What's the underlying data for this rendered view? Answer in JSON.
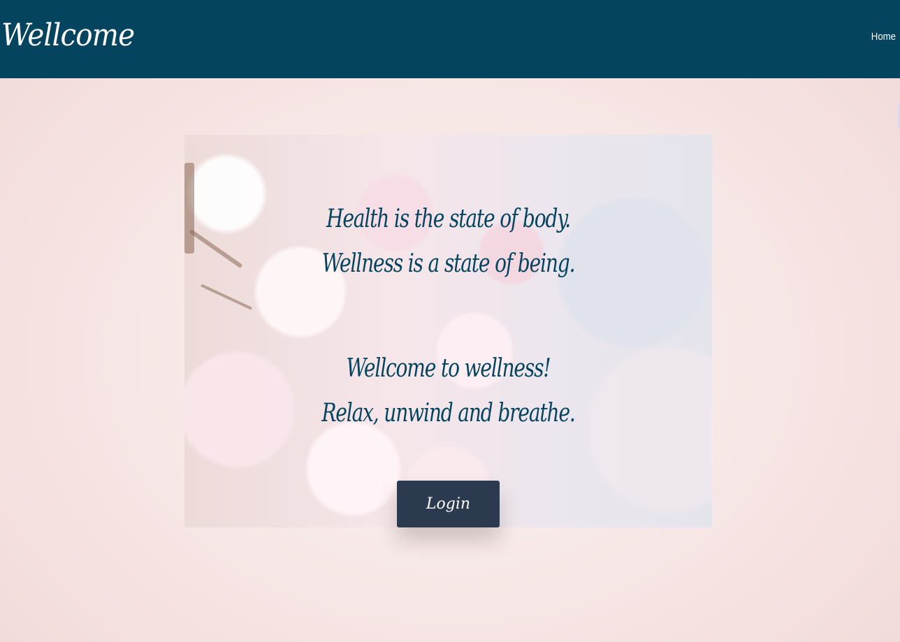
{
  "navbar": {
    "brand": "Wellcome",
    "home_link": "Home",
    "background_color": "#05445e"
  },
  "hero": {
    "lines": [
      "Health is the state of body.",
      "Wellness is a state of being.",
      "Wellcome to wellness!",
      "Relax, unwind and breathe."
    ],
    "text_color": "#05445e"
  },
  "login_button": {
    "label": "Login",
    "background_color": "#2b3a4f"
  }
}
